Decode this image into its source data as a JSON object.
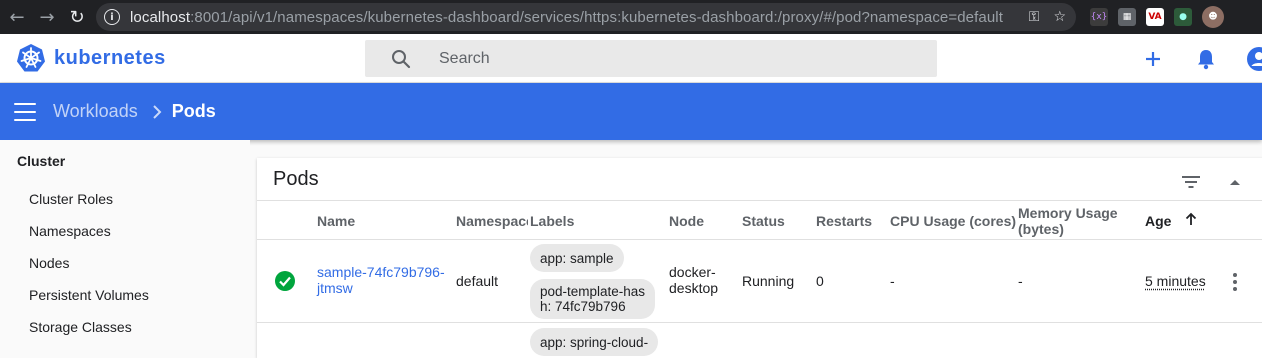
{
  "browser": {
    "url_host": "localhost",
    "url_rest": ":8001/api/v1/namespaces/kubernetes-dashboard/services/https:kubernetes-dashboard:/proxy/#/pod?namespace=default"
  },
  "app": {
    "logo_text": "kubernetes",
    "search_placeholder": "Search",
    "accent_color": "#326ce5"
  },
  "breadcrumb": {
    "parent": "Workloads",
    "current": "Pods"
  },
  "sidebar": {
    "section": "Cluster",
    "items": [
      "Cluster Roles",
      "Namespaces",
      "Nodes",
      "Persistent Volumes",
      "Storage Classes"
    ]
  },
  "card": {
    "title": "Pods",
    "columns": {
      "name": "Name",
      "namespace": "Namespace",
      "labels": "Labels",
      "node": "Node",
      "status": "Status",
      "restarts": "Restarts",
      "cpu": "CPU Usage (cores)",
      "memory_line1": "Memory Usage",
      "memory_line2": "(bytes)",
      "age": "Age"
    },
    "rows": [
      {
        "name_line1": "sample-74fc79b796-",
        "name_line2": "jtmsw",
        "namespace": "default",
        "label1": "app: sample",
        "label2_line1": "pod-template-has",
        "label2_line2": "h: 74fc79b796",
        "node_line1": "docker-",
        "node_line2": "desktop",
        "status": "Running",
        "restarts": "0",
        "cpu": "-",
        "memory": "-",
        "age": "5 minutes",
        "status_icon": "check-circle-icon"
      },
      {
        "label1": "app: spring-cloud-"
      }
    ]
  }
}
